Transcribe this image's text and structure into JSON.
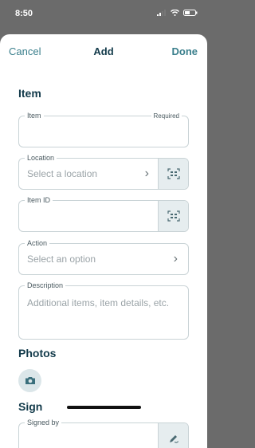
{
  "status": {
    "time": "8:50"
  },
  "nav": {
    "cancel": "Cancel",
    "title": "Add",
    "done": "Done"
  },
  "sections": {
    "item": "Item",
    "photos": "Photos",
    "sign": "Sign"
  },
  "fields": {
    "item": {
      "label": "Item",
      "required": "Required",
      "value": ""
    },
    "location": {
      "label": "Location",
      "placeholder": "Select a location"
    },
    "item_id": {
      "label": "Item ID",
      "value": ""
    },
    "action": {
      "label": "Action",
      "placeholder": "Select an option"
    },
    "description": {
      "label": "Description",
      "placeholder": "Additional items, item details, etc."
    },
    "signed_by": {
      "label": "Signed by",
      "value": ""
    }
  },
  "colors": {
    "accent": "#3a7f8c",
    "heading": "#123a4a",
    "border": "#c9d3d6"
  },
  "icons": [
    "signal-icon",
    "wifi-icon",
    "battery-icon",
    "chevron-right-icon",
    "barcode-scan-icon",
    "camera-icon",
    "signature-icon"
  ]
}
